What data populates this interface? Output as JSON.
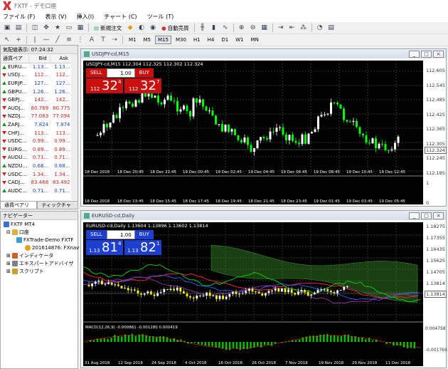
{
  "app": {
    "title": "FXTF - デモ口座"
  },
  "menu": [
    "ファイル (F)",
    "表示 (V)",
    "挿入(I)",
    "チャート (C)",
    "ツール (T)"
  ],
  "toolbar": {
    "new_order": "新規注文",
    "auto_trade": "自動売買",
    "timeframes": [
      "M1",
      "M5",
      "M15",
      "M30",
      "H1",
      "H4",
      "D1",
      "W1",
      "MN"
    ],
    "active_tf": "M15"
  },
  "market_watch": {
    "header": "気配値表示: 07:24:32",
    "columns": [
      "通貨ペア",
      "Bid",
      "Ask"
    ],
    "rows": [
      {
        "sym": "EURU...",
        "bid": "1.13...",
        "ask": "1.13...",
        "dir": "up",
        "color": "blue"
      },
      {
        "sym": "USDJ...",
        "bid": "112...",
        "ask": "112...",
        "dir": "dn",
        "color": "red"
      },
      {
        "sym": "EURJP...",
        "bid": "127...",
        "ask": "127...",
        "dir": "up",
        "color": "blue"
      },
      {
        "sym": "GBPU...",
        "bid": "1.26...",
        "ask": "1.26...",
        "dir": "up",
        "color": "blue"
      },
      {
        "sym": "GBPJ...",
        "bid": "142...",
        "ask": "142...",
        "dir": "dn",
        "color": "red"
      },
      {
        "sym": "AUDJ...",
        "bid": "80.769",
        "ask": "80.775",
        "dir": "dn",
        "color": "red"
      },
      {
        "sym": "NZDJ...",
        "bid": "77.083",
        "ask": "77.094",
        "dir": "dn",
        "color": "red"
      },
      {
        "sym": "ZARJ...",
        "bid": "7.824",
        "ask": "7.874",
        "dir": "up",
        "color": "blue"
      },
      {
        "sym": "CHFJ...",
        "bid": "113...",
        "ask": "113...",
        "dir": "dn",
        "color": "red"
      },
      {
        "sym": "USDC...",
        "bid": "0.99...",
        "ask": "0.99...",
        "dir": "dn",
        "color": "red"
      },
      {
        "sym": "EURG...",
        "bid": "0.89...",
        "ask": "0.89...",
        "dir": "dn",
        "color": "red"
      },
      {
        "sym": "AUDU...",
        "bid": "0.71...",
        "ask": "0.71...",
        "dir": "dn",
        "color": "red"
      },
      {
        "sym": "NZDU...",
        "bid": "0.68...",
        "ask": "0.68...",
        "dir": "up",
        "color": "blue"
      },
      {
        "sym": "USDC...",
        "bid": "1.34...",
        "ask": "1.34...",
        "dir": "dn",
        "color": "red"
      },
      {
        "sym": "CADJ...",
        "bid": "83.468",
        "ask": "83.492",
        "dir": "dn",
        "color": "red"
      },
      {
        "sym": "AUDC...",
        "bid": "0.71...",
        "ask": "0.71...",
        "dir": "up",
        "color": "blue"
      }
    ],
    "tabs": [
      "通貨ペアリスト",
      "ティックチャート"
    ]
  },
  "navigator": {
    "header": "ナビゲーター",
    "items": [
      "FXTF MT4",
      "口座",
      "FXTrade-Demo FXTF",
      "201614876: FXnav",
      "インディケータ",
      "エキスパートアドバイザ",
      "スクリプト"
    ]
  },
  "chart1": {
    "title": "USDJPY-cd,M15",
    "info": "USDJPY-cd,M15  112.304 112.325 112.302 112.324",
    "sell": "SELL",
    "buy": "BUY",
    "lot": "1.00",
    "bid_prefix": "112",
    "bid_big": "32",
    "bid_sup": "4",
    "ask_prefix": "112",
    "ask_big": "32",
    "ask_sup": "7",
    "price_labels": [
      "112.605",
      "112.545",
      "112.485",
      "112.425",
      "112.365",
      "112.305",
      "112.245",
      "112.185"
    ],
    "current_price": "112.324",
    "upper_time_labels": [
      "18 Dec 2018",
      "18 Dec 20:45",
      "18 Dec 22:45",
      "19 Dec 00:45",
      "19 Dec 02:45",
      "19 Dec 04:45",
      "19 Dec 06:45",
      "19 Dec 08:45",
      "19 Dec 10:45",
      "19 Dec 12:45"
    ],
    "lower_time_labels": [
      "18 Dec 2018",
      "18 Dec 13:45",
      "18 Dec 15:45",
      "18 Dec 17:45",
      "18 Dec 19:45",
      "18 Dec 21:45",
      "18 Dec 23:45",
      "19 Dec 01:45",
      "19 Dec 03:45",
      "19 Dec 05:45"
    ],
    "sub_labels": [
      "1",
      "0"
    ]
  },
  "chart2": {
    "title": "EURUSD-cd,Daily",
    "info": "EURUSD-cd,Daily  1.13604 1.13896 1.13602 1.13814",
    "sell": "SELL",
    "buy": "BUY",
    "lot": "1.00",
    "bid_prefix": "1.13",
    "bid_big": "81",
    "bid_sup": "4",
    "ask_prefix": "1.13",
    "ask_big": "82",
    "ask_sup": "1",
    "price_labels": [
      "1.18275",
      "1.17355",
      "1.16435",
      "1.15625",
      "1.14705",
      "1.13814",
      "1.12950"
    ],
    "current_price": "1.13814",
    "macd_label": "MACD(12,26,9) -0.000861 -0.001280 0.000419",
    "macd_scale": [
      "0.004758",
      "-0.001769"
    ],
    "time_labels": [
      "31 Aug 2018",
      "12 Sep 2018",
      "24 Sep 2018",
      "4 Oct 2018",
      "16 Oct 2018",
      "26 Oct 2018",
      "7 Nov 2018",
      "19 Nov 2018",
      "29 Nov 2018",
      "11 Dec 2018"
    ]
  },
  "colors": {
    "bull": "#ffffff",
    "bear": "#00ff00",
    "sell_red": "#c81010",
    "buy_blue": "#1c3fd0"
  }
}
